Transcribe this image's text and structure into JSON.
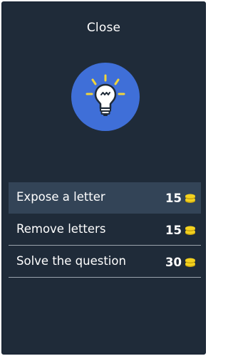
{
  "header": {
    "close_label": "Close"
  },
  "hint_icon": {
    "name": "lightbulb-icon",
    "circle_color": "#3f6fd8",
    "ray_color": "#f0d53c"
  },
  "options": [
    {
      "label": "Expose a letter",
      "price": "15",
      "highlighted": true
    },
    {
      "label": "Remove letters",
      "price": "15",
      "highlighted": false
    },
    {
      "label": "Solve the question",
      "price": "30",
      "highlighted": false
    }
  ],
  "coin": {
    "name": "coins-icon",
    "color": "#f4d21f"
  },
  "colors": {
    "background": "#1f2b39",
    "highlight": "#334457",
    "divider": "#9aa3ad"
  }
}
